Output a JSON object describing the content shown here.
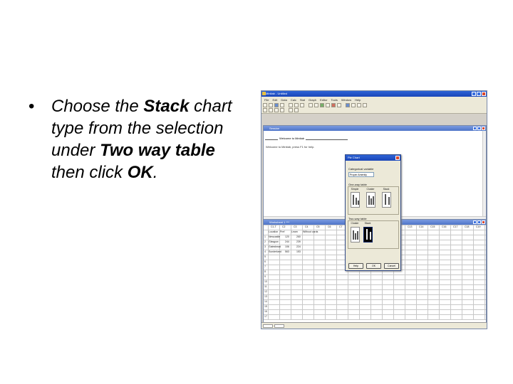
{
  "slide": {
    "bullet_symbol": "•",
    "text_1": "Choose the ",
    "bold_1": "Stack",
    "text_2": " chart type from the selection under ",
    "bold_2": "Two way table",
    "text_3": " then click ",
    "bold_3": "OK",
    "text_4": "."
  },
  "app": {
    "title": "Minitab - Untitled",
    "menu": [
      "File",
      "Edit",
      "Data",
      "Calc",
      "Stat",
      "Graph",
      "Editor",
      "Tools",
      "Window",
      "Help"
    ],
    "colors": {
      "titlebar": "#1a45b8",
      "window_bg": "#d4d0c8",
      "selected_icon": "#000000"
    }
  },
  "session": {
    "title": "Session",
    "header": "Welcome to Minitab",
    "line": "Welcome to Minitab, press F1 for help."
  },
  "worksheet": {
    "title": "Worksheet 1 ***",
    "columns": [
      "C1-T",
      "C2",
      "C3",
      "C4",
      "C5",
      "C6",
      "C7",
      "C8",
      "C9",
      "C10",
      "C11",
      "C12",
      "C13",
      "C14",
      "C15",
      "C16",
      "C17",
      "C18",
      "C19"
    ],
    "headers": [
      "Location",
      "Pref",
      "Learn",
      "Without cards"
    ],
    "rows": [
      [
        "Newcastle",
        "120",
        "260"
      ],
      [
        "Glasgow",
        "244",
        "239"
      ],
      [
        "Gateshead",
        "106",
        "224"
      ],
      [
        "Sunderland",
        "563",
        "153"
      ]
    ],
    "row_count": 17
  },
  "dialog": {
    "title": "Pie Chart",
    "variable_label": "Categorical variable",
    "variable_value": "Proper Amenity",
    "one_way_label": "One-way table",
    "one_way_types": [
      "Simple",
      "Cluster",
      "Stack"
    ],
    "two_way_label": "Two-way table",
    "two_way_types": [
      "Cluster",
      "Stack"
    ],
    "selected_type": "Stack",
    "buttons": {
      "help": "Help",
      "ok": "OK",
      "cancel": "Cancel"
    }
  }
}
